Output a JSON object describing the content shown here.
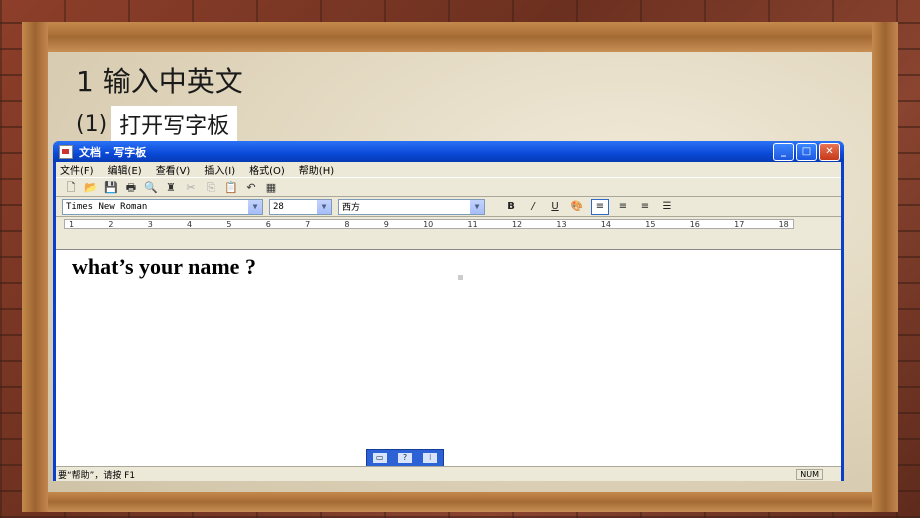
{
  "slide": {
    "title": "1 输入中英文",
    "step_num": "(1)",
    "step_text": "打开写字板"
  },
  "window": {
    "title": "文档 - 写字板",
    "controls": {
      "minimize": "_",
      "maximize": "□",
      "close": "✕"
    }
  },
  "menu": [
    "文件(F)",
    "编辑(E)",
    "查看(V)",
    "插入(I)",
    "格式(O)",
    "帮助(H)"
  ],
  "toolbar": {
    "icons": [
      "new-icon",
      "open-icon",
      "save-icon",
      "print-icon",
      "print-preview-icon",
      "find-icon",
      "cut-icon",
      "copy-icon",
      "paste-icon",
      "undo-icon",
      "datetime-icon"
    ]
  },
  "format_bar": {
    "font": "Times New Roman",
    "size": "28",
    "script": "西方",
    "bold": "B",
    "italic": "/",
    "underline": "U"
  },
  "ruler": {
    "ticks": [
      "1",
      "2",
      "3",
      "4",
      "5",
      "6",
      "7",
      "8",
      "9",
      "10",
      "11",
      "12",
      "13",
      "14",
      "15",
      "16",
      "17",
      "18"
    ]
  },
  "document": {
    "text": "what’s your name ?"
  },
  "status": {
    "help_text": "要“帮助”，请按 F1",
    "num": "NUM"
  }
}
